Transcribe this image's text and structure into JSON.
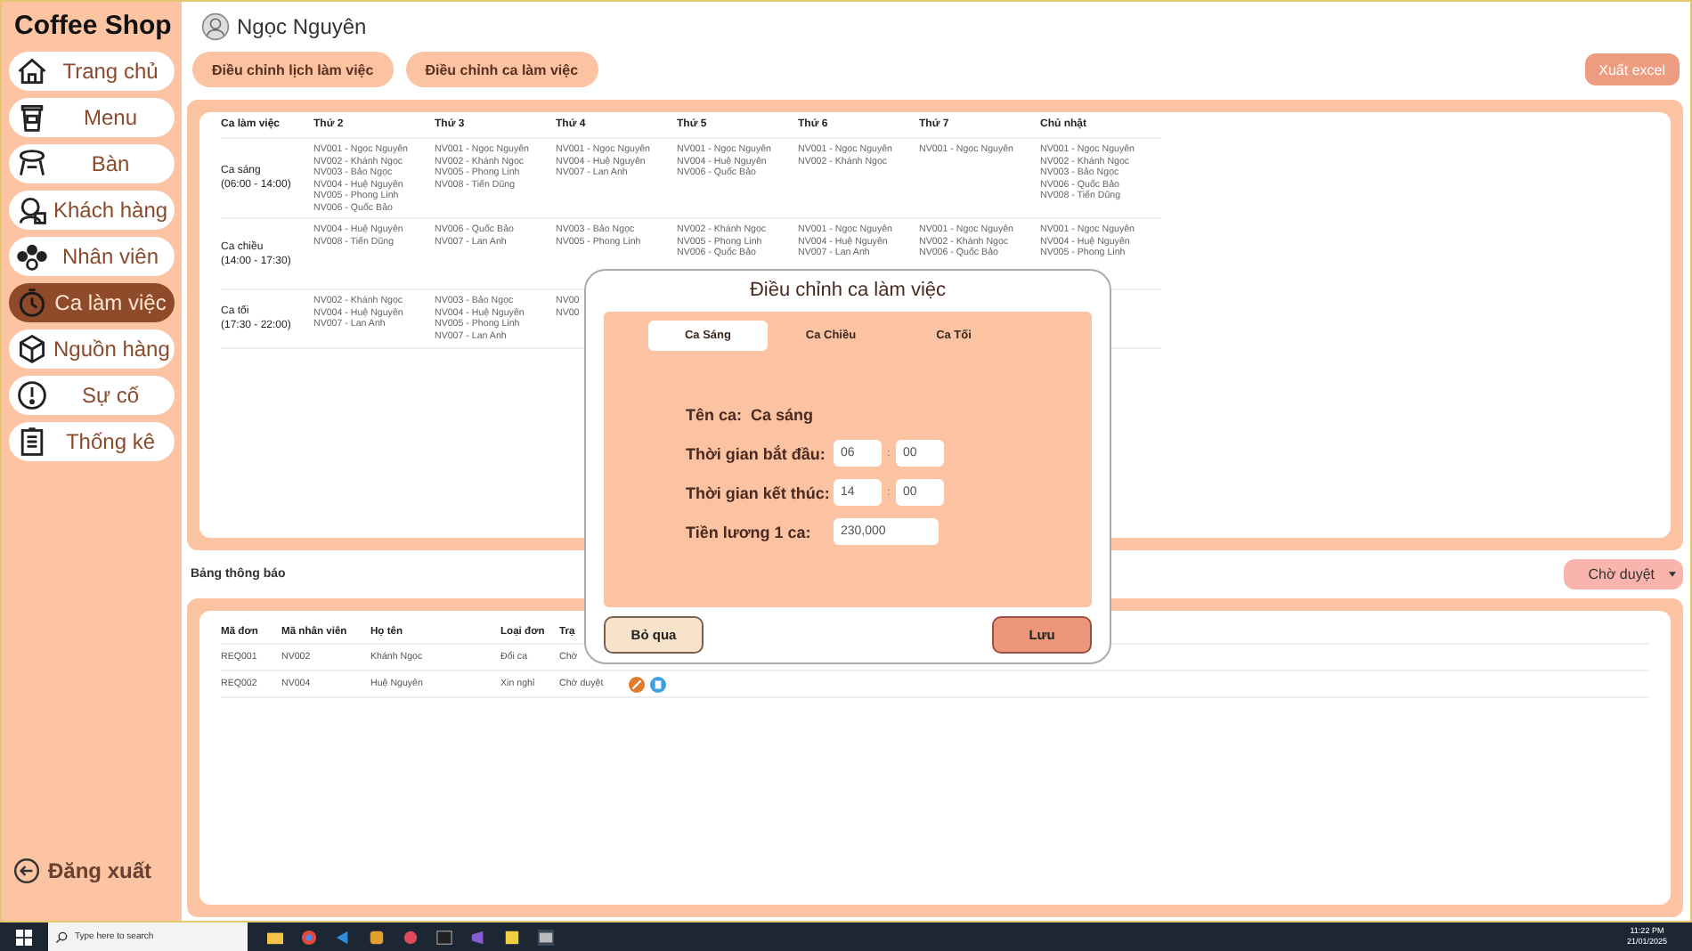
{
  "app": {
    "title": "Coffee Shop"
  },
  "sidebar": {
    "items": [
      {
        "label": "Trang chủ",
        "selected": false
      },
      {
        "label": "Menu",
        "selected": false
      },
      {
        "label": "Bàn",
        "selected": false
      },
      {
        "label": "Khách hàng",
        "selected": false
      },
      {
        "label": "Nhân viên",
        "selected": false
      },
      {
        "label": "Ca làm việc",
        "selected": true
      },
      {
        "label": "Nguồn hàng",
        "selected": false
      },
      {
        "label": "Sự cố",
        "selected": false
      },
      {
        "label": "Thống kê",
        "selected": false
      }
    ],
    "logout": "Đăng xuất"
  },
  "user": {
    "name": "Ngọc Nguyên"
  },
  "toolbar": {
    "buttons": [
      "Điều chỉnh lịch làm việc",
      "Điều chỉnh ca làm việc"
    ],
    "export": "Xuất excel"
  },
  "schedule": {
    "columns": [
      "Ca làm việc",
      "Thứ 2",
      "Thứ 3",
      "Thứ 4",
      "Thứ 5",
      "Thứ 6",
      "Thứ 7",
      "Chủ nhật"
    ],
    "rows": [
      {
        "cells": [
          [
            "Ca sáng",
            "(06:00 - 14:00)"
          ],
          [
            "NV001 - Ngọc Nguyên",
            "NV002 - Khánh Ngọc",
            "NV003 - Bảo Ngọc",
            "NV004 - Huệ Nguyên",
            "NV005 - Phong Linh",
            "NV006 - Quốc Bảo"
          ],
          [
            "NV001 - Ngọc Nguyên",
            "NV002 - Khánh Ngọc",
            "NV005 - Phong Linh",
            "NV008 - Tiến Dũng"
          ],
          [
            "NV001 - Ngọc Nguyên",
            "NV004 - Huệ Nguyên",
            "NV007 - Lan Anh"
          ],
          [
            "NV001 - Ngọc Nguyên",
            "NV004 - Huệ Nguyên",
            "NV006 - Quốc Bảo"
          ],
          [
            "NV001 - Ngọc Nguyên",
            "NV002 - Khánh Ngọc"
          ],
          [
            "NV001 - Ngọc Nguyên"
          ],
          [
            "NV001 - Ngọc Nguyên",
            "NV002 - Khánh Ngọc",
            "NV003 - Bảo Ngọc",
            "NV006 - Quốc Bảo",
            "NV008 - Tiến Dũng"
          ]
        ]
      },
      {
        "cells": [
          [
            "Ca chiều",
            "(14:00 - 17:30)"
          ],
          [
            "NV004 - Huệ Nguyên",
            "NV008 - Tiến Dũng"
          ],
          [
            "NV006 - Quốc Bảo",
            "NV007 - Lan Anh"
          ],
          [
            "NV003 - Bảo Ngọc",
            "NV005 - Phong Linh"
          ],
          [
            "NV002 - Khánh Ngọc",
            "NV005 - Phong Linh",
            "NV006 - Quốc Bảo"
          ],
          [
            "NV001 - Ngọc Nguyên",
            "NV004 - Huệ Nguyên",
            "NV007 - Lan Anh"
          ],
          [
            "NV001 - Ngọc Nguyên",
            "NV002 - Khánh Ngọc",
            "NV006 - Quốc Bảo"
          ],
          [
            "NV001 - Ngọc Nguyên",
            "NV004 - Huệ Nguyên",
            "NV005 - Phong Linh"
          ]
        ]
      },
      {
        "cells": [
          [
            "Ca tối",
            "(17:30 - 22:00)"
          ],
          [
            "NV002 - Khánh Ngọc",
            "NV004 - Huệ Nguyên",
            "NV007 - Lan Anh"
          ],
          [
            "NV003 - Bảo Ngọc",
            "NV004 - Huệ Nguyên",
            "NV005 - Phong Linh",
            "NV007 - Lan Anh"
          ],
          [
            "NV00",
            "NV00"
          ]
        ]
      }
    ]
  },
  "notifications": {
    "title": "Bảng thông báo",
    "filter": "Chờ duyệt",
    "columns": [
      "Mã đơn",
      "Mã nhân viên",
      "Họ tên",
      "Loại đơn",
      "Trạ"
    ],
    "rows": [
      {
        "cells": [
          "REQ001",
          "NV002",
          "Khánh Ngọc",
          "Đổi ca",
          "Chờ"
        ],
        "actions": false
      },
      {
        "cells": [
          "REQ002",
          "NV004",
          "Huệ Nguyên",
          "Xin nghỉ",
          "Chờ duyệt"
        ],
        "actions": true
      }
    ]
  },
  "dialog": {
    "title": "Điều chỉnh ca làm việc",
    "tabs": [
      {
        "label": "Ca Sáng",
        "selected": true
      },
      {
        "label": "Ca Chiều",
        "selected": false
      },
      {
        "label": "Ca Tối",
        "selected": false
      }
    ],
    "name_label": "Tên ca:",
    "name_value": "Ca sáng",
    "times": [
      {
        "label": "Thời gian bắt đầu:",
        "hour": "06",
        "separator": ":",
        "minute": "00"
      },
      {
        "label": "Thời gian kết thúc:",
        "hour": "14",
        "separator": ":",
        "minute": "00"
      }
    ],
    "wage_label": "Tiền lương 1 ca:",
    "wage_value": "230,000",
    "cancel": "Bỏ qua",
    "save": "Lưu"
  },
  "taskbar": {
    "search_placeholder": "Type here to search",
    "time": "11:22 PM",
    "date": "21/01/2025"
  }
}
